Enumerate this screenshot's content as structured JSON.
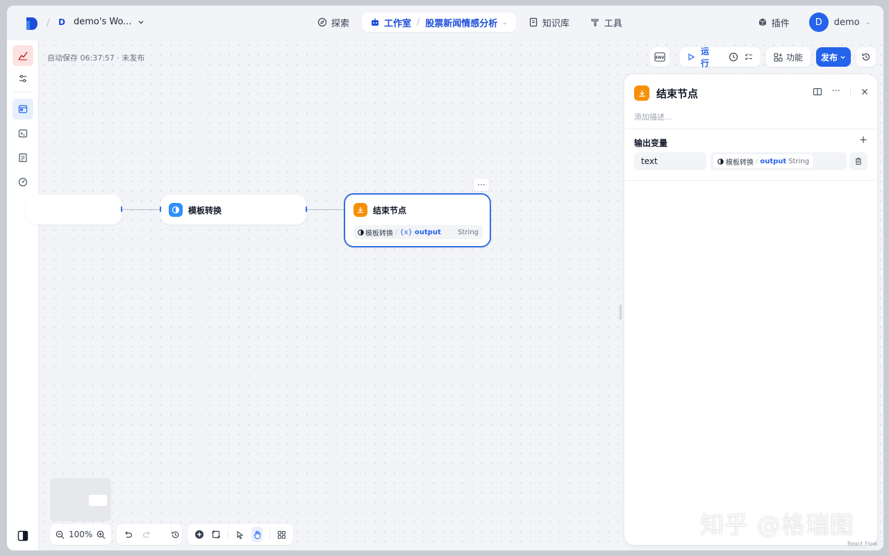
{
  "topbar": {
    "workspace_initial": "D",
    "workspace_name": "demo's Wo...",
    "nav": {
      "explore": "探索",
      "studio": "工作室",
      "app_name": "股票新闻情感分析",
      "knowledge": "知识库",
      "tools": "工具"
    },
    "plugins": "插件",
    "user_initial": "D",
    "user_name": "demo"
  },
  "canvas": {
    "autosave": "自动保存 06:37:57 · 未发布",
    "env_label": "ENV",
    "run_label": "运行",
    "features_label": "功能",
    "publish_label": "发布"
  },
  "nodes": {
    "template": {
      "title": "模板转换"
    },
    "end": {
      "title": "结束节点",
      "var_source": "模板转换",
      "var_symbol": "{x}",
      "var_name": "output",
      "var_type": "String"
    }
  },
  "panel": {
    "title": "结束节点",
    "description_placeholder": "添加描述...",
    "output_section": "输出变量",
    "output_var_name": "text",
    "output_var_source": "模板转换",
    "output_var_ref": "output",
    "output_var_type": "String"
  },
  "bottom_toolbar": {
    "zoom": "100%"
  },
  "watermark": "知乎 @格瑞图",
  "footer_brand": "React Flow",
  "colors": {
    "accent": "#2563eb",
    "start_icon": "#2e90fa",
    "end_icon": "#f79009",
    "app_icon_bg": "#fde2e2"
  }
}
